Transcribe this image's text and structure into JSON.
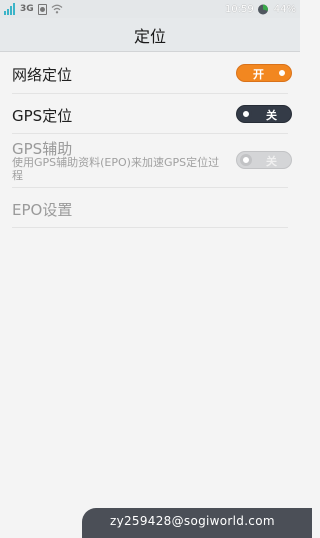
{
  "status_bar": {
    "network_type": "3G",
    "time": "10:59",
    "battery_percent": "44%",
    "icons": [
      "signal-icon",
      "sim-icon",
      "wifi-icon",
      "battery-icon"
    ]
  },
  "header": {
    "title": "定位"
  },
  "settings": {
    "network_location": {
      "label": "网络定位",
      "toggle_label": "开",
      "state": "on"
    },
    "gps_location": {
      "label": "GPS定位",
      "toggle_label": "关",
      "state": "off"
    },
    "gps_assist": {
      "label": "GPS辅助",
      "description": "使用GPS辅助资料(EPO)来加速GPS定位过程",
      "toggle_label": "关",
      "state": "off",
      "disabled": true
    },
    "epo_settings": {
      "label": "EPO设置",
      "disabled": true
    }
  },
  "watermark": {
    "text": "zy259428@sogiworld.com"
  },
  "colors": {
    "accent_on": "#f28720",
    "toggle_off": "#343b47",
    "toggle_disabled": "#d4d5d7",
    "header_bg": "#e6e9eb"
  }
}
